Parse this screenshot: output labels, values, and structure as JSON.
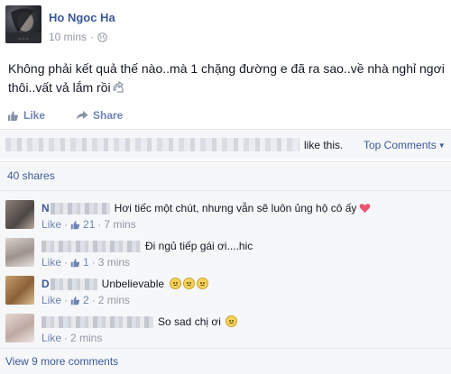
{
  "colors": {
    "link": "#3b5998",
    "action": "#6d84b4",
    "meta": "#9197a3",
    "panel": "#f6f7f9",
    "heart": "#e9546e"
  },
  "post": {
    "author": "Ho Ngoc Ha",
    "time": "10 mins",
    "separator": "·",
    "privacy_icon": "globe-icon",
    "text": "Không phải kết quả thế nào..mà 1 chặng đường e đã ra sao..về nhà nghỉ ngơi thôi..vất vả lắm rồi"
  },
  "actions": {
    "like": "Like",
    "share": "Share"
  },
  "likes": {
    "suffix": "like this.",
    "sort_label": "Top Comments"
  },
  "shares": {
    "label": "40 shares"
  },
  "comments": [
    {
      "name": "N",
      "text": "Hơi tiếc một chút, nhưng vẫn sẽ luôn ủng hộ cô ấy",
      "like": "Like",
      "sep": "·",
      "likes": "21",
      "time": "7 mins",
      "trailing_icon": "heart-icon"
    },
    {
      "name": "",
      "text": "Đi ngủ tiếp gái ơi....hic",
      "like": "Like",
      "sep": "·",
      "likes": "1",
      "time": "3 mins"
    },
    {
      "name": "D",
      "text": "Unbelievable",
      "like": "Like",
      "sep": "·",
      "likes": "2",
      "time": "2 mins",
      "trailing_icon": "crying-face-icon"
    },
    {
      "name": "",
      "text": "So sad chị ơi",
      "like": "Like",
      "sep": "·",
      "likes": "",
      "time": "2 mins",
      "trailing_icon": "sad-face-icon"
    }
  ],
  "view_more": "View 9 more comments"
}
